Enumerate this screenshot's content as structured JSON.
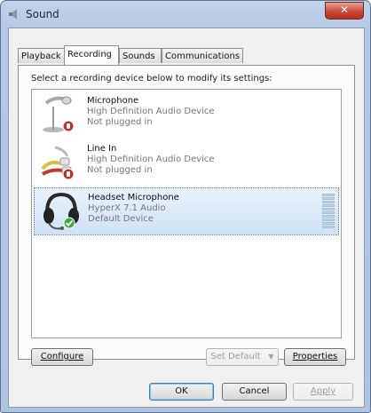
{
  "window": {
    "title": "Sound",
    "close_glyph": "✕"
  },
  "tabs": [
    {
      "label": "Playback",
      "active": false
    },
    {
      "label": "Recording",
      "active": true
    },
    {
      "label": "Sounds",
      "active": false
    },
    {
      "label": "Communications",
      "active": false
    }
  ],
  "instruction": "Select a recording device below to modify its settings:",
  "devices": [
    {
      "name": "Microphone",
      "description": "High Definition Audio Device",
      "status": "Not plugged in",
      "icon": "microphone-icon",
      "state_icon": "unplugged-badge-icon"
    },
    {
      "name": "Line In",
      "description": "High Definition Audio Device",
      "status": "Not plugged in",
      "icon": "line-in-cable-icon",
      "state_icon": "unplugged-badge-icon"
    },
    {
      "name": "Headset Microphone",
      "description": "HyperX 7.1 Audio",
      "status": "Default Device",
      "icon": "headset-icon",
      "state_icon": "default-check-icon",
      "selected": true
    }
  ],
  "buttons": {
    "configure": "Configure",
    "set_default": "Set Default",
    "set_default_arrow": "▼",
    "properties": "Properties",
    "ok": "OK",
    "cancel": "Cancel",
    "apply": "Apply"
  },
  "colors": {
    "selection": "#cfe2f7",
    "default_check": "#3aa83a",
    "unplugged_badge": "#c0302a"
  }
}
